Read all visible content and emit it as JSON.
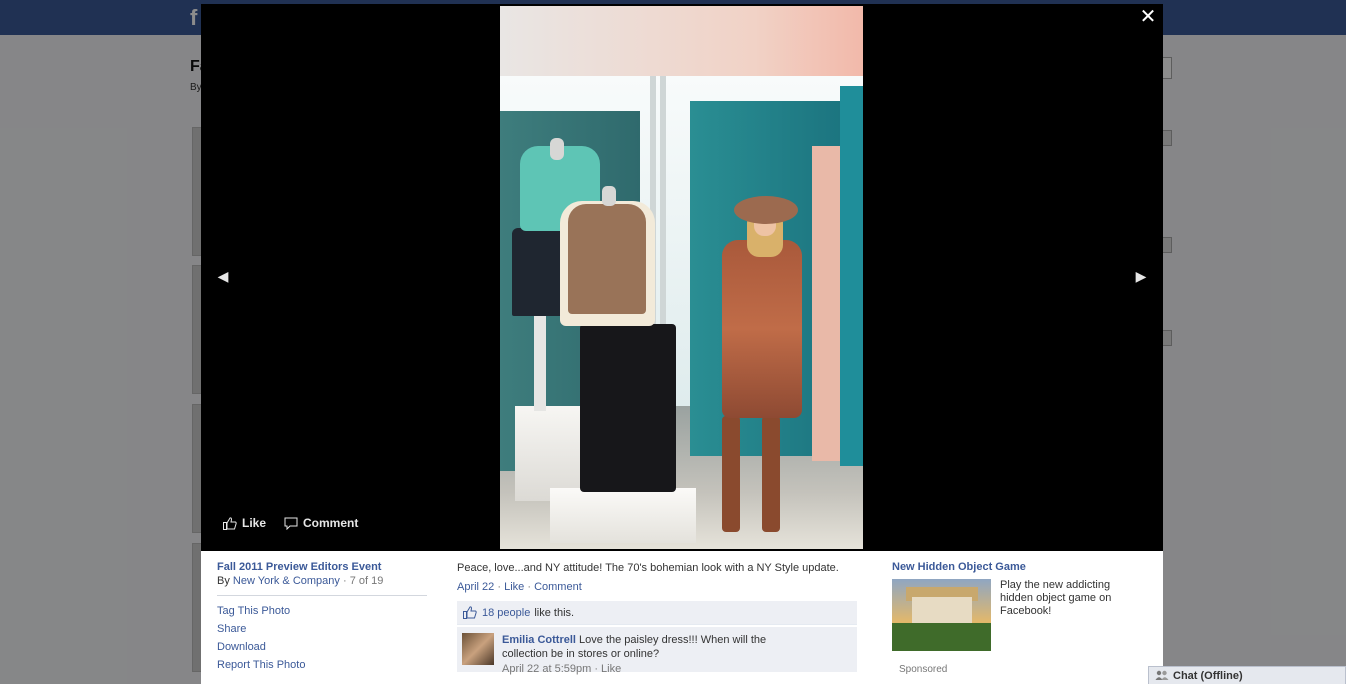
{
  "background": {
    "logo": "f",
    "title": "Fa",
    "byline": "By"
  },
  "viewer": {
    "close_glyph": "✕",
    "prev_glyph": "◀",
    "next_glyph": "▶",
    "stage_actions": {
      "like": "Like",
      "comment": "Comment"
    },
    "photo": {
      "icon": "photo-fashion-display"
    }
  },
  "info": {
    "album_title": "Fall 2011 Preview Editors Event",
    "by_prefix": "By",
    "owner": "New York & Company",
    "position": "· 7 of 19",
    "actions": [
      "Tag This Photo",
      "Share",
      "Download",
      "Report This Photo"
    ],
    "caption": "Peace, love...and NY attitude! The 70's bohemian look with a NY Style update.",
    "date": "April 22",
    "sep": "·",
    "like_link": "Like",
    "comment_link": "Comment",
    "likes_count": "18 people",
    "likes_suffix": "like this.",
    "comment": {
      "author": "Emilia Cottrell",
      "text": "Love the paisley dress!!! When will the collection be in stores or online?",
      "meta": "April 22 at 5:59pm · Like"
    }
  },
  "ad": {
    "title": "New Hidden Object Game",
    "text": "Play the new addicting hidden object game on Facebook!",
    "sponsored": "Sponsored"
  },
  "chat": {
    "label": "Chat (Offline)"
  },
  "colors": {
    "brand": "#3b5998",
    "stage": "#000000",
    "link": "#3b5998"
  }
}
